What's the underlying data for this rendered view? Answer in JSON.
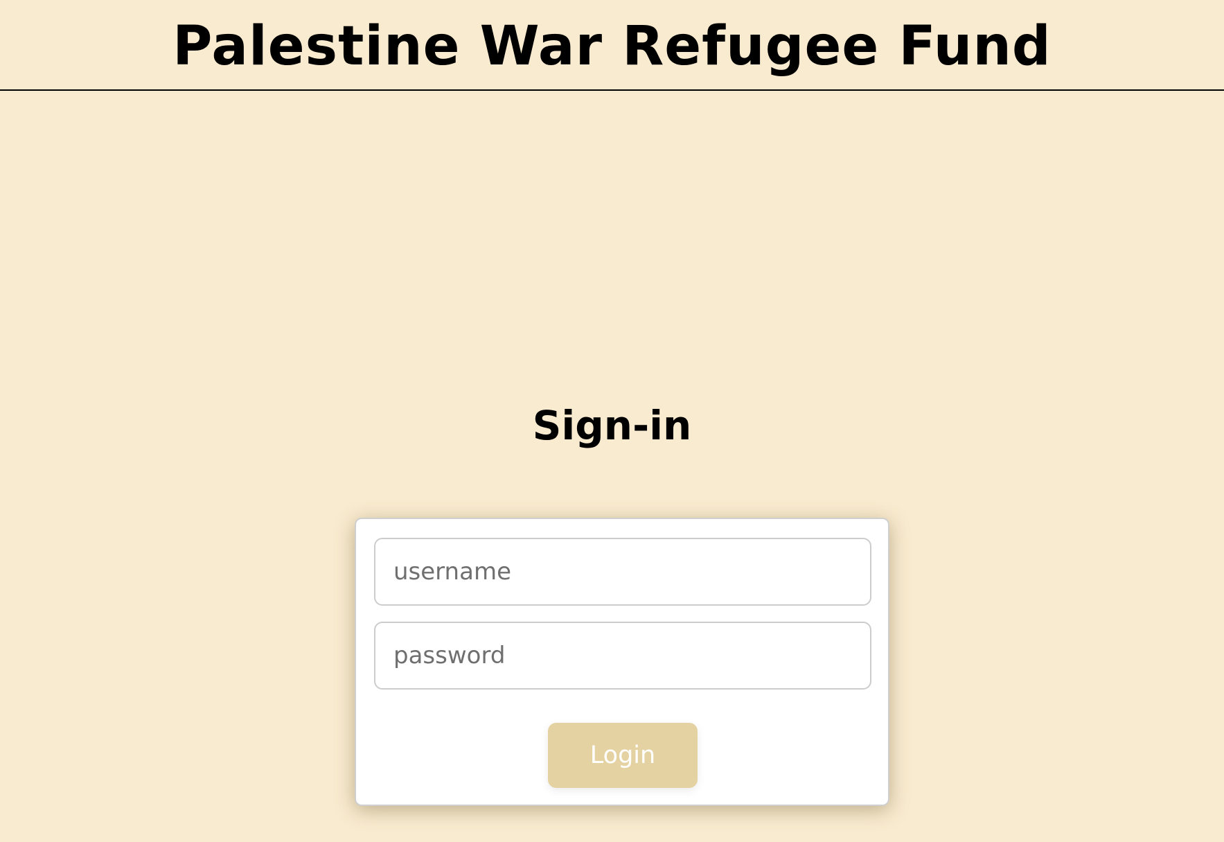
{
  "header": {
    "title": "Palestine War Refugee Fund"
  },
  "signin": {
    "heading": "Sign-in"
  },
  "form": {
    "username_placeholder": "username",
    "password_placeholder": "password",
    "login_label": "Login"
  },
  "colors": {
    "background": "#f9ebcf",
    "button": "#e4d2a2",
    "card": "#ffffff",
    "text": "#000000"
  }
}
